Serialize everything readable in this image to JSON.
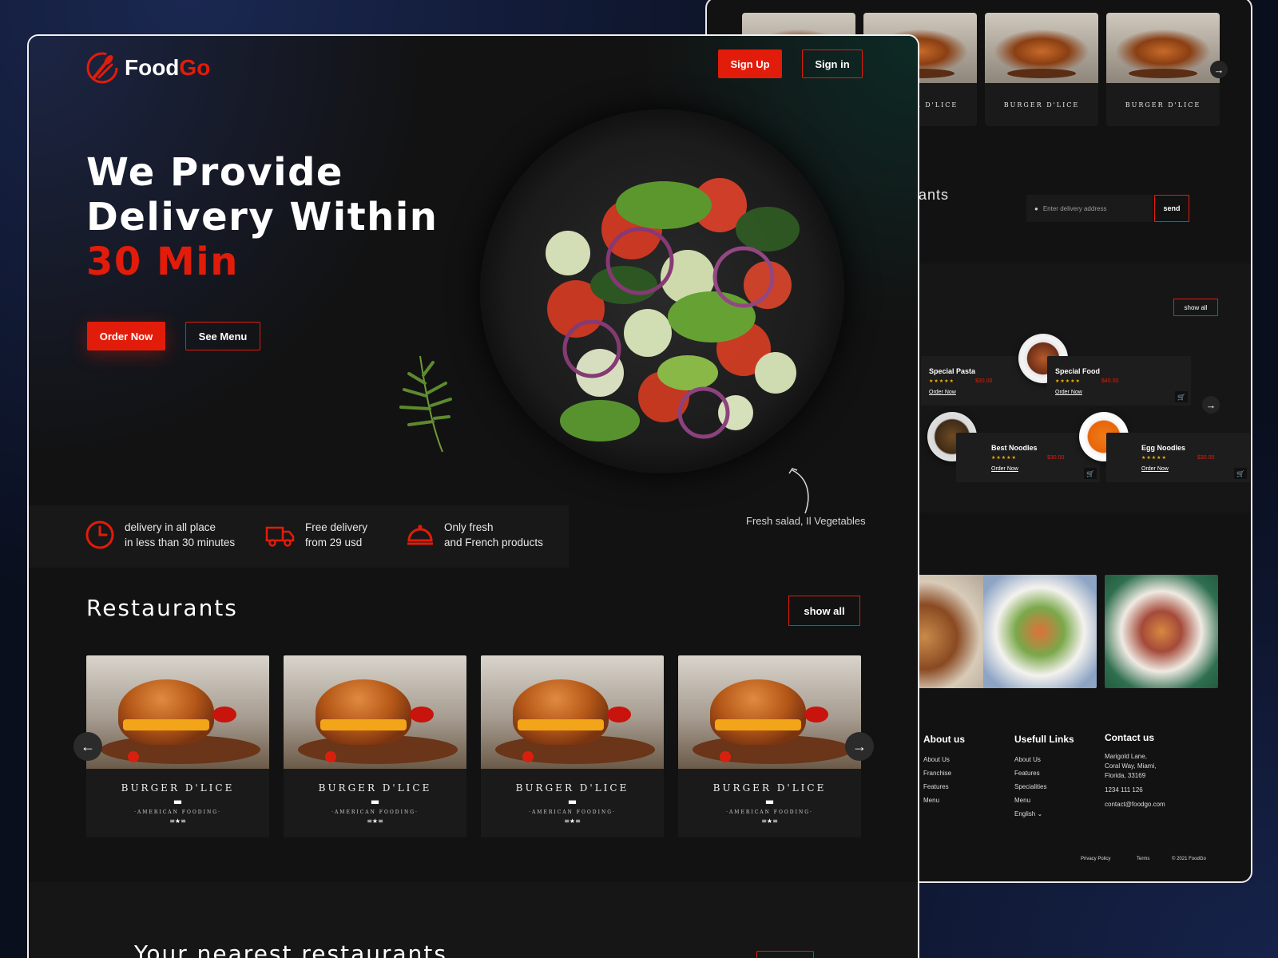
{
  "brand": {
    "name_part1": "Food",
    "name_part2": "Go",
    "accent": "#e21c0a"
  },
  "header": {
    "signup_label": "Sign Up",
    "signin_label": "Sign in"
  },
  "hero": {
    "line1": "We Provide",
    "line2": "Delivery Within",
    "line3": "30 Min",
    "order_label": "Order Now",
    "menu_label": "See Menu",
    "caption": "Fresh salad, Il Vegetables"
  },
  "features": [
    {
      "icon": "clock-icon",
      "line1": "delivery in all place",
      "line2": "in less than 30 minutes"
    },
    {
      "icon": "truck-icon",
      "line1": "Free delivery",
      "line2": "from 29 usd"
    },
    {
      "icon": "cloche-icon",
      "line1": "Only fresh",
      "line2": "and French products"
    }
  ],
  "restaurants": {
    "title": "Restaurants",
    "show_all": "show all",
    "cards": [
      {
        "name": "BURGER D'LICE",
        "tag": "·AMERICAN FOODING·"
      },
      {
        "name": "BURGER D'LICE",
        "tag": "·AMERICAN FOODING·"
      },
      {
        "name": "BURGER D'LICE",
        "tag": "·AMERICAN FOODING·"
      },
      {
        "name": "BURGER D'LICE",
        "tag": "·AMERICAN FOODING·"
      }
    ]
  },
  "nearest": {
    "title": "Your nearest restaurants"
  },
  "back": {
    "thumb_logo": "BURGER D'LICE",
    "section_title_partial": "rants",
    "address_placeholder": "Enter delivery address",
    "send_label": "send",
    "menu_show_all": "show all",
    "dishes": [
      {
        "name": "Special Pasta",
        "stars": "★★★★★",
        "price": "$30.00",
        "link": "Order Now"
      },
      {
        "name": "Special Food",
        "stars": "★★★★★",
        "price": "$40.00",
        "link": "Order Now"
      },
      {
        "name": "Best Noodles",
        "stars": "★★★★★",
        "price": "$30.00",
        "link": "Order Now"
      },
      {
        "name": "Egg Noodles",
        "stars": "★★★★★",
        "price": "$30.00",
        "link": "Order Now"
      }
    ],
    "footer": {
      "about_title": "About us",
      "about_links": [
        "About Us",
        "Franchise",
        "Features",
        "Menu"
      ],
      "useful_title": "Usefull Links",
      "useful_links": [
        "About Us",
        "Features",
        "Specialities",
        "Menu"
      ],
      "language": "English",
      "contact_title": "Contact us",
      "address1": "Marigold Lane,",
      "address2": "Coral Way, Miami,",
      "address3": "Florida, 33169",
      "phone": "1234 111 126",
      "email": "contact@foodgo.com",
      "privacy": "Privacy Policy",
      "terms": "Terms",
      "copyright": "© 2021 FoodGo"
    }
  }
}
